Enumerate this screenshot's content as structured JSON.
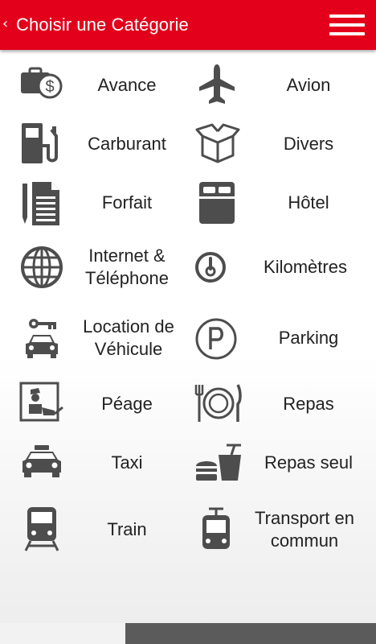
{
  "header": {
    "back_glyph": "‹",
    "title": "Choisir une Catégorie",
    "accent_color": "#e3001b"
  },
  "categories": [
    {
      "label": "Avance",
      "icon": "cash-advance-icon"
    },
    {
      "label": "Avion",
      "icon": "airplane-icon"
    },
    {
      "label": "Carburant",
      "icon": "fuel-pump-icon"
    },
    {
      "label": "Divers",
      "icon": "open-box-icon"
    },
    {
      "label": "Forfait",
      "icon": "document-icon"
    },
    {
      "label": "Hôtel",
      "icon": "hotel-bed-icon"
    },
    {
      "label": "Internet &\nTéléphone",
      "icon": "globe-icon"
    },
    {
      "label": "Kilomètres",
      "icon": "gauge-icon"
    },
    {
      "label": "Location de\nVéhicule",
      "icon": "car-key-icon"
    },
    {
      "label": "Parking",
      "icon": "parking-icon"
    },
    {
      "label": "Péage",
      "icon": "toll-booth-icon"
    },
    {
      "label": "Repas",
      "icon": "plate-fork-knife-icon"
    },
    {
      "label": "Taxi",
      "icon": "taxi-icon"
    },
    {
      "label": "Repas seul",
      "icon": "fast-food-icon"
    },
    {
      "label": "Train",
      "icon": "train-icon"
    },
    {
      "label": "Transport en\ncommun",
      "icon": "tram-icon"
    }
  ]
}
